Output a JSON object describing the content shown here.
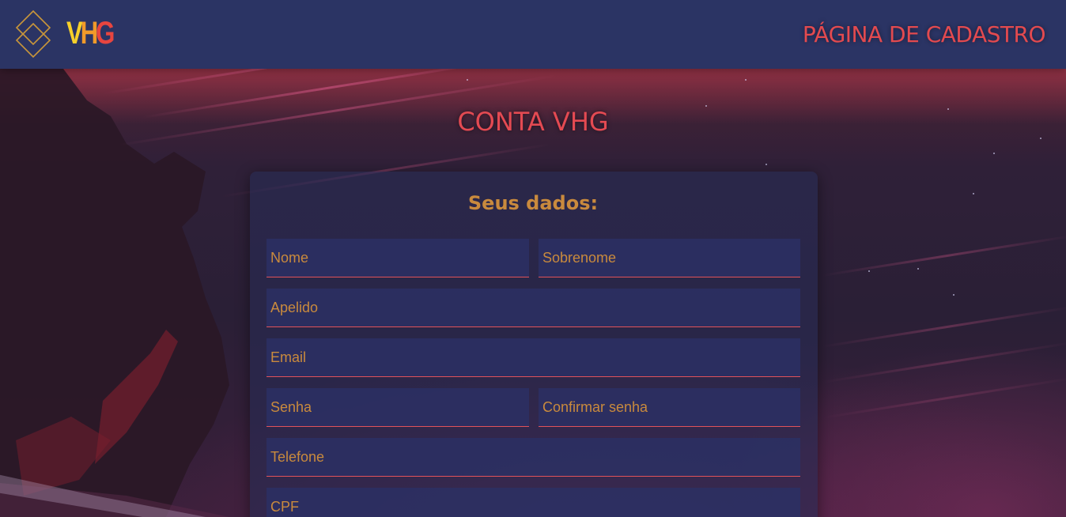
{
  "header": {
    "logo_letters": {
      "v": "V",
      "h": "H",
      "g": "G"
    },
    "title": "PÁGINA DE CADASTRO"
  },
  "main": {
    "title": "CONTA VHG",
    "card_title": "Seus dados:"
  },
  "form": {
    "nome": {
      "placeholder": "Nome",
      "value": ""
    },
    "sobrenome": {
      "placeholder": "Sobrenome",
      "value": ""
    },
    "apelido": {
      "placeholder": "Apelido",
      "value": ""
    },
    "email": {
      "placeholder": "Email",
      "value": ""
    },
    "senha": {
      "placeholder": "Senha",
      "value": ""
    },
    "confirmar_senha": {
      "placeholder": "Confirmar senha",
      "value": ""
    },
    "telefone": {
      "placeholder": "Telefone",
      "value": ""
    },
    "cpf": {
      "placeholder": "CPF",
      "value": ""
    }
  },
  "colors": {
    "header_bg": "#2b3464",
    "accent_red": "#e34a4f",
    "label_gold": "#c98a3d",
    "logo_yellow": "#f7d02a",
    "logo_orange": "#f19a2a",
    "logo_red": "#e8453f",
    "diamond_gold": "#c9963a"
  },
  "icons": {
    "logo_mark": "double-diamond-icon"
  }
}
